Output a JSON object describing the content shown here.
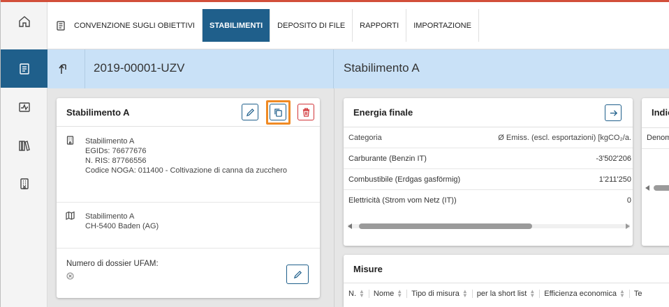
{
  "nav": {
    "tabs": [
      {
        "label": "CONVENZIONE SUGLI OBIETTIVI"
      },
      {
        "label": "STABILIMENTI"
      },
      {
        "label": "DEPOSITO DI FILE"
      },
      {
        "label": "RAPPORTI"
      },
      {
        "label": "IMPORTAZIONE"
      }
    ],
    "active_tab": "STABILIMENTI"
  },
  "rail": {
    "items": [
      "home-icon",
      "document-icon",
      "chart-icon",
      "library-icon",
      "building-icon"
    ],
    "active_item": "document-icon"
  },
  "header": {
    "case_id": "2019-00001-UZV",
    "site_title": "Stabilimento A"
  },
  "site_card": {
    "title": "Stabilimento A",
    "details": {
      "name": "Stabilimento A",
      "egids": "EGIDs: 76677676",
      "ris": "N. RIS: 87766556",
      "noga": "Codice NOGA: 011400 - Coltivazione di canna da zucchero"
    },
    "address": {
      "name": "Stabilimento A",
      "city": "CH-5400 Baden (AG)"
    },
    "dossier": {
      "label": "Numero di dossier UFAM:"
    }
  },
  "energy_card": {
    "title": "Energia finale",
    "columns": [
      "Categoria",
      "Ø Emiss. (escl. esportazioni) [kgCO₂/a."
    ],
    "rows": [
      {
        "category": "Carburante (Benzin IT)",
        "value": "-3'502'206"
      },
      {
        "category": "Combustibile (Erdgas gasförmig)",
        "value": "1'211'250"
      },
      {
        "category": "Elettricità (Strom vom Netz (IT))",
        "value": "0"
      }
    ]
  },
  "indicator_card": {
    "title": "Indicatori",
    "column": "Denominazione"
  },
  "measures_card": {
    "title": "Misure",
    "columns": [
      "N.",
      "Nome",
      "Tipo di misura",
      "per la short list",
      "Efficienza economica",
      "Te"
    ]
  },
  "colors": {
    "accent": "#1f5f8b",
    "band": "#c9e1f7",
    "top_line": "#d24f3a",
    "delete": "#d13438",
    "highlight": "#f08a24"
  }
}
